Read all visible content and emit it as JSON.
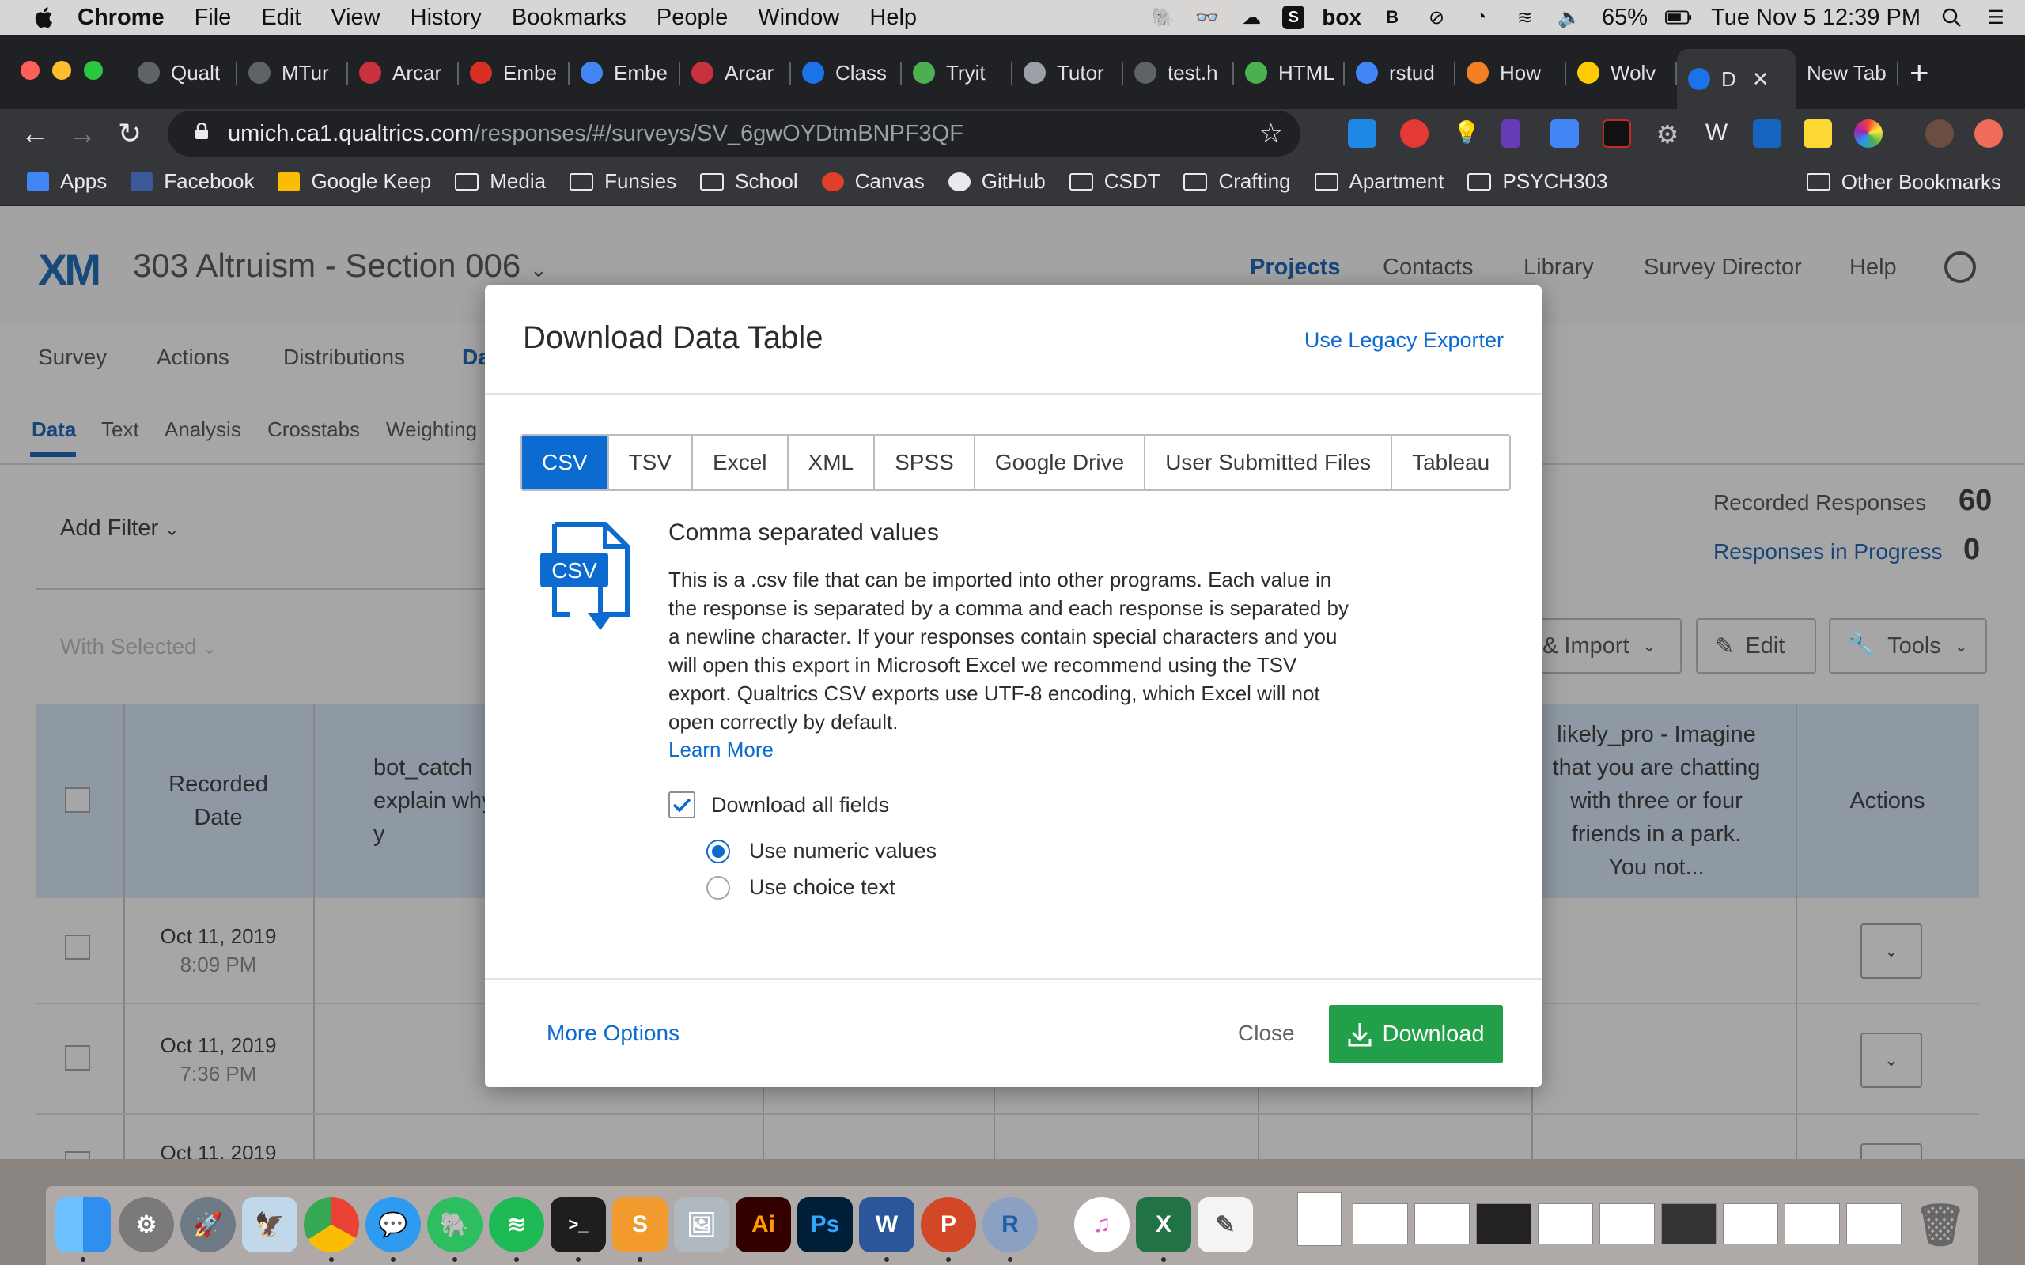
{
  "menubar": {
    "items": [
      "Chrome",
      "File",
      "Edit",
      "View",
      "History",
      "Bookmarks",
      "People",
      "Window",
      "Help"
    ],
    "battery": "65%",
    "clock": "Tue Nov 5  12:39 PM"
  },
  "tabs": [
    {
      "label": "Qualt",
      "fav_color": "#5f6368"
    },
    {
      "label": "MTur",
      "fav_color": "#5f6368"
    },
    {
      "label": "Arcar",
      "fav_color": "#c8323c"
    },
    {
      "label": "Embe",
      "fav_color": "#d93025"
    },
    {
      "label": "Embe",
      "fav_color": "#4285f4"
    },
    {
      "label": "Arcar",
      "fav_color": "#c8323c"
    },
    {
      "label": "Class",
      "fav_color": "#1a73e8"
    },
    {
      "label": "Tryit",
      "fav_color": "#4caf50"
    },
    {
      "label": "Tutor",
      "fav_color": "#9aa0a6"
    },
    {
      "label": "test.h",
      "fav_color": "#5f6368"
    },
    {
      "label": "HTML",
      "fav_color": "#4caf50"
    },
    {
      "label": "rstud",
      "fav_color": "#4285f4"
    },
    {
      "label": "How",
      "fav_color": "#f48024"
    },
    {
      "label": "Wolv",
      "fav_color": "#ffcb05"
    },
    {
      "label": "D",
      "fav_color": "#1a73e8",
      "active": true
    },
    {
      "label": "New Tab",
      "fav_color": "none"
    }
  ],
  "url": {
    "host": "umich.ca1.qualtrics.com",
    "path": "/responses/#/surveys/SV_6gwOYDtmBNPF3QF"
  },
  "bookmarks": [
    {
      "label": "Apps",
      "kind": "apps"
    },
    {
      "label": "Facebook",
      "kind": "facebook"
    },
    {
      "label": "Google Keep",
      "kind": "keep"
    },
    {
      "label": "Media",
      "kind": "folder"
    },
    {
      "label": "Funsies",
      "kind": "folder"
    },
    {
      "label": "School",
      "kind": "folder"
    },
    {
      "label": "Canvas",
      "kind": "canvas"
    },
    {
      "label": "GitHub",
      "kind": "github"
    },
    {
      "label": "CSDT",
      "kind": "folder"
    },
    {
      "label": "Crafting",
      "kind": "folder"
    },
    {
      "label": "Apartment",
      "kind": "folder"
    },
    {
      "label": "PSYCH303",
      "kind": "folder"
    }
  ],
  "other_bookmarks": "Other Bookmarks",
  "qualtrics": {
    "logo": "XM",
    "project_title": "303 Altruism - Section 006",
    "top_nav": [
      "Projects",
      "Contacts",
      "Library",
      "Survey Director",
      "Help"
    ],
    "project_tabs": [
      "Survey",
      "Actions",
      "Distributions",
      "Da"
    ],
    "sub_tabs": [
      "Data",
      "Text",
      "Analysis",
      "Crosstabs",
      "Weighting"
    ],
    "add_filter": "Add Filter",
    "with_selected": "With Selected",
    "recorded_responses_label": "Recorded Responses",
    "recorded_responses": "60",
    "in_progress_label": "Responses in Progress",
    "in_progress": "0",
    "buttons": {
      "import": "& Import",
      "edit": "Edit",
      "tools": "Tools"
    },
    "columns": {
      "recorded_date": "Recorded Date",
      "bot_catch": "bot_catch explain why y",
      "likely_pro": "likely_pro - Imagine that you are chatting with three or four friends in a park. You not...",
      "actions": "Actions"
    },
    "rows": [
      {
        "date": "Oct 11, 2019",
        "time": "8:09 PM"
      },
      {
        "date": "Oct 11, 2019",
        "time": "7:36 PM"
      },
      {
        "date": "Oct 11, 2019",
        "time": ""
      }
    ]
  },
  "modal": {
    "title": "Download Data Table",
    "legacy_link": "Use Legacy Exporter",
    "formats": [
      "CSV",
      "TSV",
      "Excel",
      "XML",
      "SPSS",
      "Google Drive",
      "User Submitted Files",
      "Tableau"
    ],
    "selected_format": "CSV",
    "icon_label": "CSV",
    "heading": "Comma separated values",
    "description": "This is a .csv file that can be imported into other programs. Each value in the response is separated by a comma and each response is separated by a newline character. If your responses contain special characters and you will open this export in Microsoft Excel we recommend using the TSV export. Qualtrics CSV exports use UTF-8 encoding, which Excel will not open correctly by default.",
    "learn_more": "Learn More",
    "download_all_fields": "Download all fields",
    "download_all_fields_checked": true,
    "radio_numeric": "Use numeric values",
    "radio_choice": "Use choice text",
    "radio_selected": "numeric",
    "more_options": "More Options",
    "close": "Close",
    "download": "Download"
  },
  "colors": {
    "accent_blue": "#0b6bd0",
    "download_green": "#22a049",
    "qualtrics_navy": "#17457a"
  }
}
